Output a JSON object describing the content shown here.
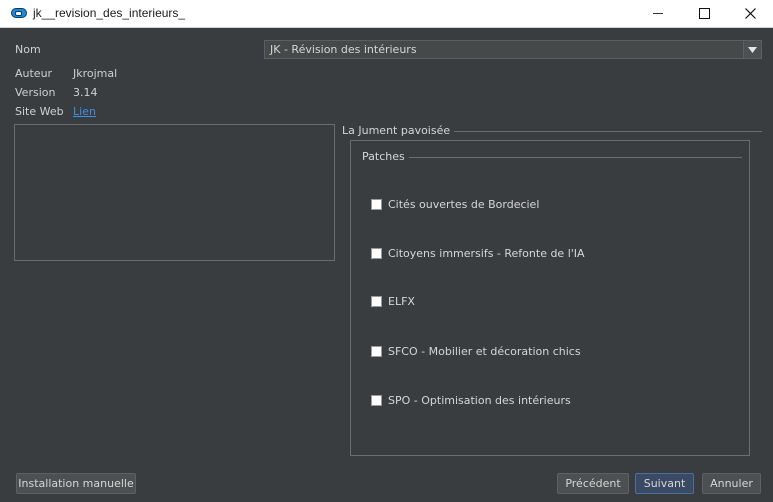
{
  "window": {
    "title": "jk__revision_des_interieurs_"
  },
  "info": {
    "name_label": "Nom",
    "author_label": "Auteur",
    "author_value": "Jkrojmal",
    "version_label": "Version",
    "version_value": "3.14",
    "website_label": "Site Web",
    "website_link": "Lien"
  },
  "combo": {
    "selected": "JK - Révision des intérieurs"
  },
  "group": {
    "title": "La Jument pavoisée",
    "patches_title": "Patches",
    "patches": [
      {
        "label": "Cités ouvertes de Bordeciel",
        "checked": false
      },
      {
        "label": "Citoyens immersifs - Refonte de l'IA",
        "checked": false
      },
      {
        "label": "ELFX",
        "checked": false
      },
      {
        "label": "SFCO - Mobilier et décoration chics",
        "checked": false
      },
      {
        "label": "SPO - Optimisation des intérieurs",
        "checked": false
      }
    ]
  },
  "buttons": {
    "manual": "Installation manuelle",
    "previous": "Précédent",
    "next": "Suivant",
    "cancel": "Annuler"
  },
  "colors": {
    "background": "#3a3d40",
    "link": "#3d8fe8",
    "primary_border": "#4a6da7"
  }
}
